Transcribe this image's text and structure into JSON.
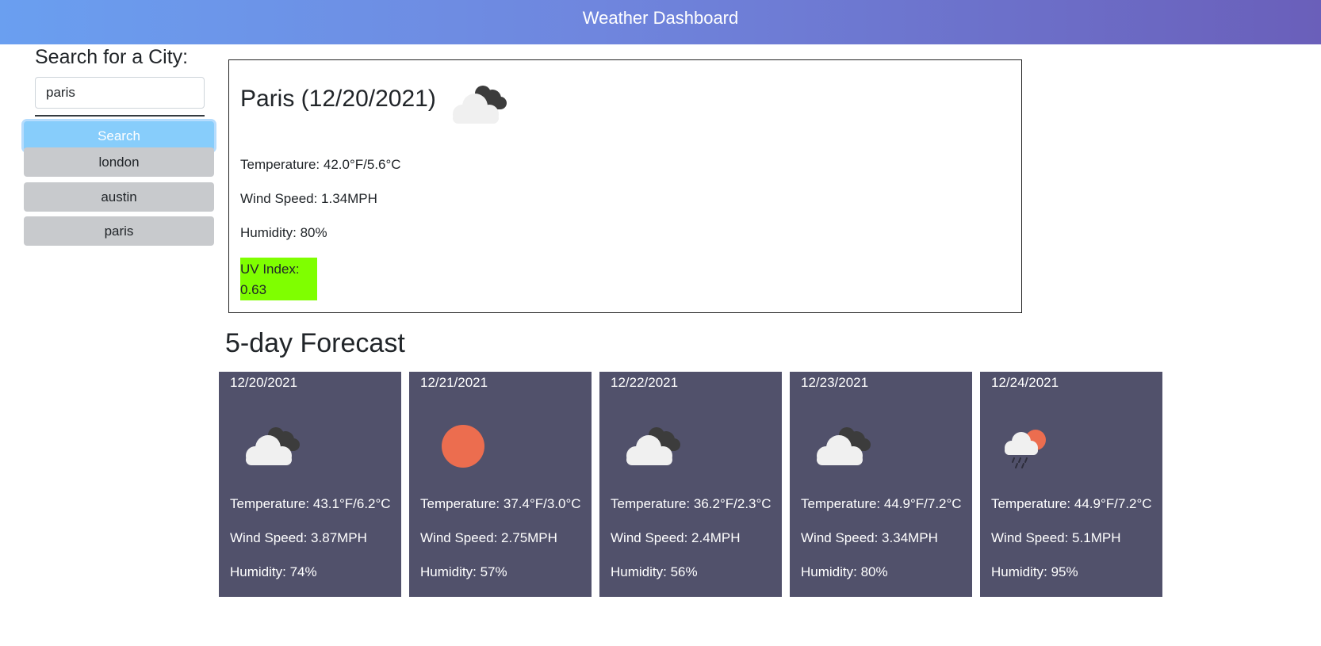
{
  "header": {
    "title": "Weather Dashboard"
  },
  "search": {
    "label": "Search for a City:",
    "value": "paris",
    "button_label": "Search"
  },
  "history": [
    "london",
    "austin",
    "paris"
  ],
  "current": {
    "city_date": "Paris (12/20/2021)",
    "icon": "cloudy-icon",
    "temperature": "Temperature: 42.0°F/5.6°C",
    "wind": "Wind Speed: 1.34MPH",
    "humidity": "Humidity: 80%",
    "uv_label": "UV Index:",
    "uv_value": "0.63",
    "uv_color": "#7fff00"
  },
  "forecast": {
    "title": "5-day Forecast",
    "days": [
      {
        "date": "12/20/2021",
        "icon": "cloudy-icon",
        "temperature": "Temperature: 43.1°F/6.2°C",
        "wind": "Wind Speed: 3.87MPH",
        "humidity": "Humidity: 74%"
      },
      {
        "date": "12/21/2021",
        "icon": "sun-icon",
        "temperature": "Temperature: 37.4°F/3.0°C",
        "wind": "Wind Speed: 2.75MPH",
        "humidity": "Humidity: 57%"
      },
      {
        "date": "12/22/2021",
        "icon": "cloudy-icon",
        "temperature": "Temperature: 36.2°F/2.3°C",
        "wind": "Wind Speed: 2.4MPH",
        "humidity": "Humidity: 56%"
      },
      {
        "date": "12/23/2021",
        "icon": "cloudy-icon",
        "temperature": "Temperature: 44.9°F/7.2°C",
        "wind": "Wind Speed: 3.34MPH",
        "humidity": "Humidity: 80%"
      },
      {
        "date": "12/24/2021",
        "icon": "rain-sun-icon",
        "temperature": "Temperature: 44.9°F/7.2°C",
        "wind": "Wind Speed: 5.1MPH",
        "humidity": "Humidity: 95%"
      }
    ]
  },
  "colors": {
    "header_gradient_start": "#6a9ff0",
    "header_gradient_end": "#6a5fba",
    "search_button": "#87cdfb",
    "history_button": "#c8cacd",
    "forecast_card": "#51516b",
    "sun": "#ec6d4f"
  }
}
